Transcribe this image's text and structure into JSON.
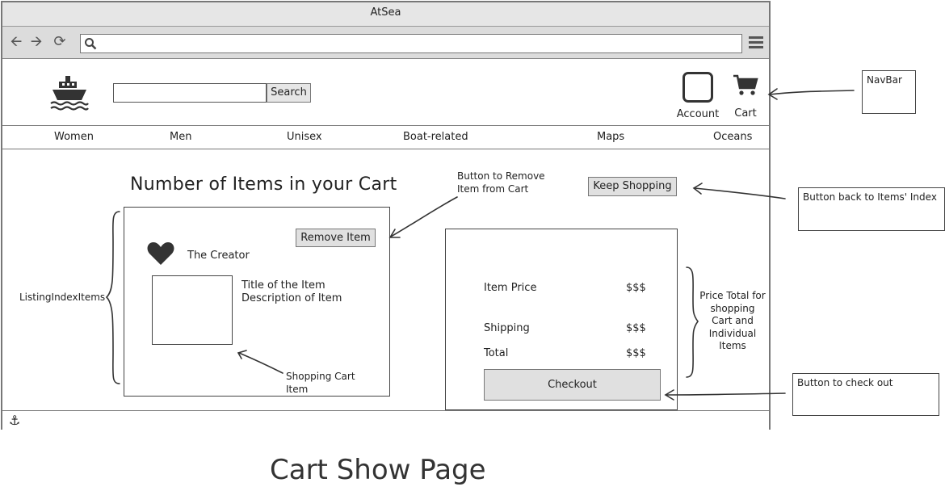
{
  "browser": {
    "title": "AtSea",
    "address_value": ""
  },
  "header": {
    "search_placeholder": "",
    "search_button": "Search",
    "account_label": "Account",
    "cart_label": "Cart"
  },
  "nav": {
    "items": [
      "Women",
      "Men",
      "Unisex",
      "Boat-related",
      "Maps",
      "Oceans"
    ]
  },
  "main": {
    "cart_heading": "Number of Items in your Cart",
    "keep_shopping_button": "Keep Shopping",
    "item": {
      "remove_button": "Remove Item",
      "creator": "The Creator",
      "title": "Title of the Item",
      "description": "Description of Item"
    },
    "summary": {
      "item_price_label": "Item Price",
      "item_price_value": "$$$",
      "shipping_label": "Shipping",
      "shipping_value": "$$$",
      "total_label": "Total",
      "total_value": "$$$",
      "checkout_button": "Checkout"
    }
  },
  "annotations": {
    "navbar": "NavBar",
    "remove_button_note_1": "Button to Remove",
    "remove_button_note_2": "Item from Cart",
    "back_button_note": "Button back to Items' Index",
    "listing_index": "ListingIndexItems",
    "price_total_1": "Price Total for",
    "price_total_2": "shopping",
    "price_total_3": "Cart and",
    "price_total_4": "Individual",
    "price_total_5": "Items",
    "shopping_cart_item_1": "Shopping Cart",
    "shopping_cart_item_2": "Item",
    "checkout_note": "Button to check out",
    "page_caption": "Cart Show Page"
  },
  "icons": {
    "logo": "ship-icon",
    "search": "search-icon",
    "account": "account-icon",
    "cart": "cart-icon",
    "favorite": "heart-icon",
    "footer": "anchor-icon",
    "menu": "hamburger-menu-icon"
  }
}
